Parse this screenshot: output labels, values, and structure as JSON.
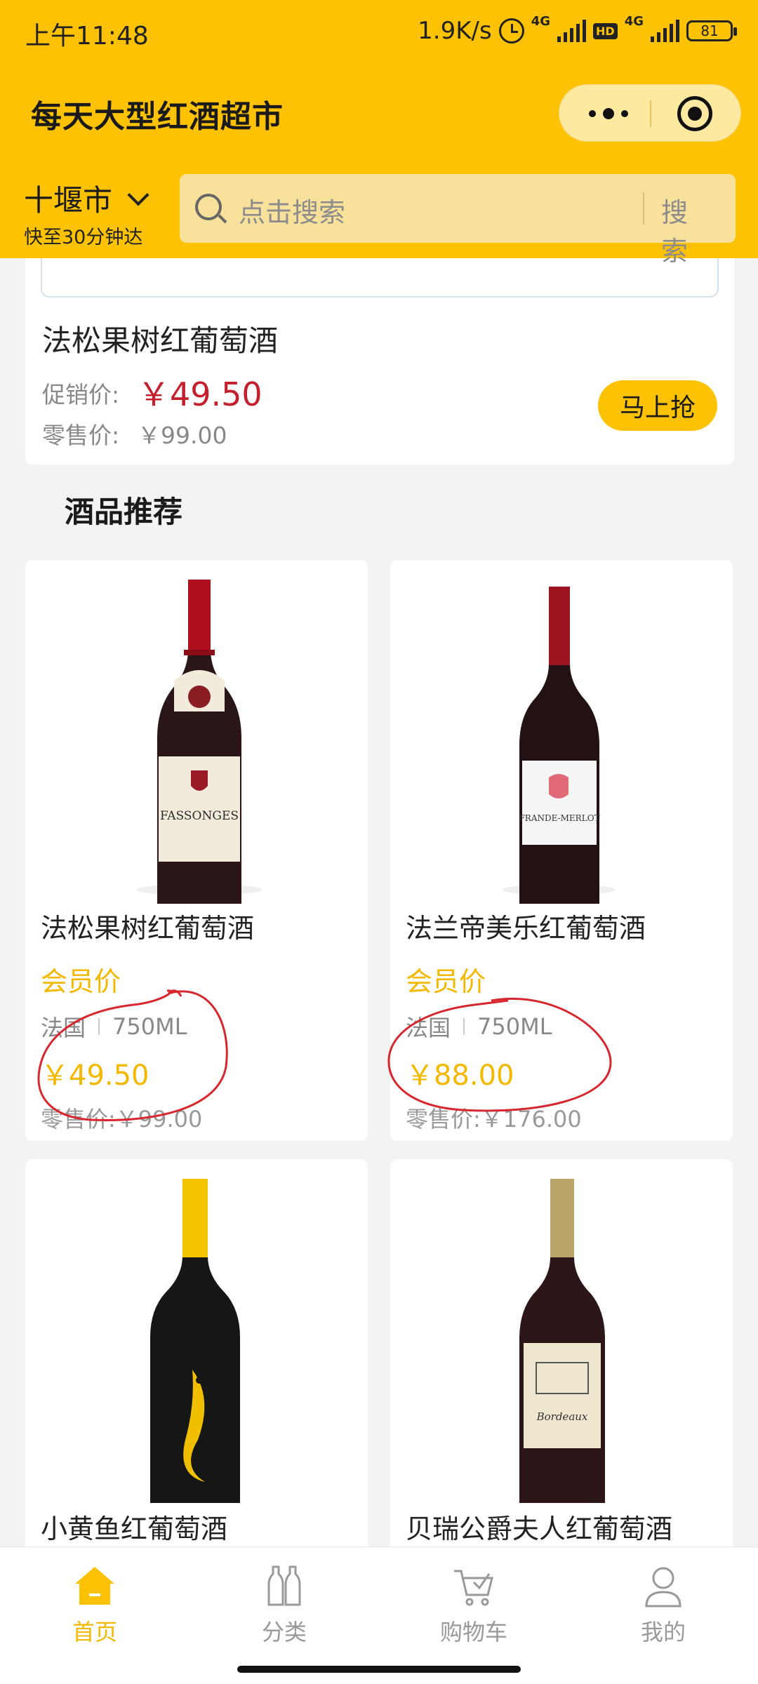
{
  "status": {
    "time": "上午11:48",
    "speed": "1.9K/s",
    "net1": "4G",
    "hd": "HD",
    "net2": "4G",
    "battery": "81"
  },
  "app": {
    "title": "每天大型红酒超市"
  },
  "location": {
    "city": "十堰市",
    "delivery": "快至30分钟达"
  },
  "search": {
    "placeholder": "点击搜索",
    "button": "搜 索"
  },
  "promo": {
    "name": "法松果树红葡萄酒",
    "price_label": "促销价:",
    "price": "￥49.50",
    "retail_label": "零售价:",
    "retail": "￥99.00",
    "button": "马上抢"
  },
  "section_title": "酒品推荐",
  "products": [
    {
      "name": "法松果树红葡萄酒",
      "member": "会员价",
      "origin": "法国",
      "volume": "750ML",
      "price": "￥49.50",
      "retail": "零售价:￥99.00",
      "label_text": "FASSONGES"
    },
    {
      "name": "法兰帝美乐红葡萄酒",
      "member": "会员价",
      "origin": "法国",
      "volume": "750ML",
      "price": "￥88.00",
      "retail": "零售价:￥176.00",
      "label_text": "FRANDE-MERLOT"
    },
    {
      "name": "小黄鱼红葡萄酒"
    },
    {
      "name": "贝瑞公爵夫人红葡萄酒",
      "label_text": "Bordeaux"
    }
  ],
  "tabs": [
    {
      "label": "首页",
      "icon": "home-icon",
      "active": true
    },
    {
      "label": "分类",
      "icon": "bottles-icon",
      "active": false
    },
    {
      "label": "购物车",
      "icon": "cart-icon",
      "active": false
    },
    {
      "label": "我的",
      "icon": "user-icon",
      "active": false
    }
  ],
  "colors": {
    "brand_yellow": "#fdc203",
    "price_red": "#c31f2c",
    "member_yellow": "#f3b800",
    "annotation_red": "#d8262e"
  }
}
